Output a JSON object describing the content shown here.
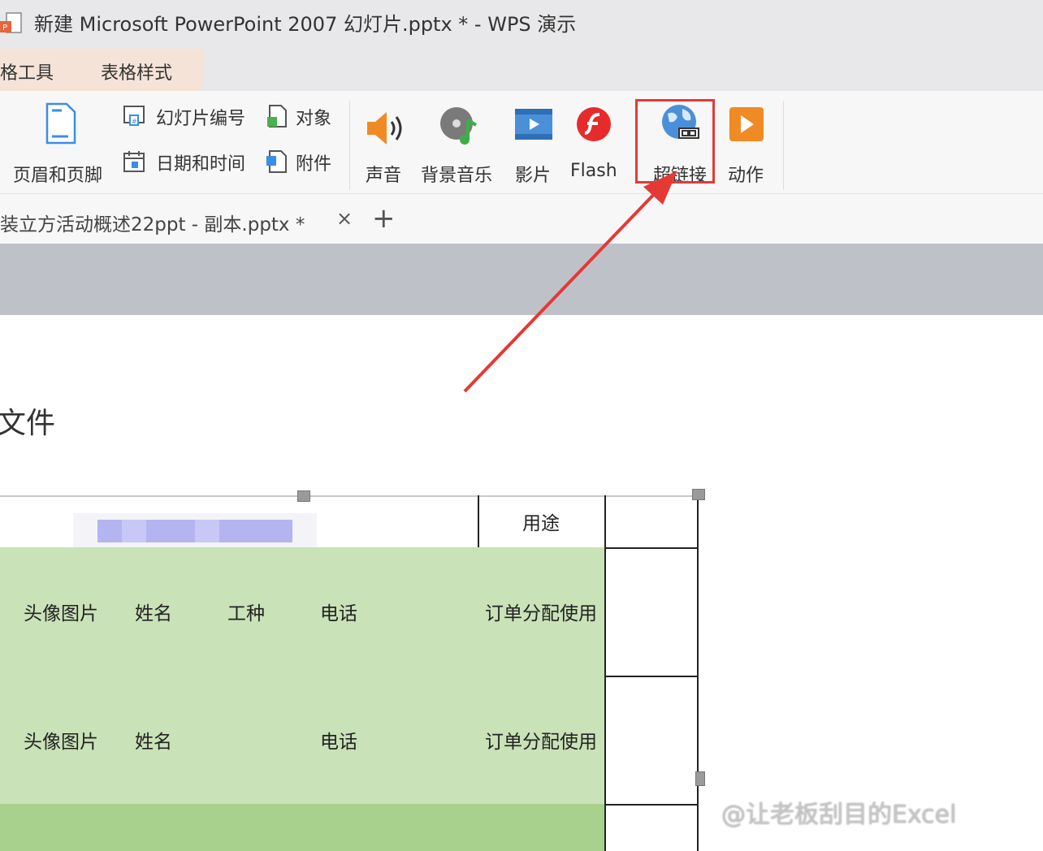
{
  "window": {
    "title": "新建 Microsoft PowerPoint 2007 幻灯片.pptx * - WPS 演示"
  },
  "context_tabs": {
    "table_tools": "格工具",
    "table_style": "表格样式"
  },
  "ribbon": {
    "header_footer": "页眉和页脚",
    "slide_number": "幻灯片编号",
    "date_time": "日期和时间",
    "object": "对象",
    "attachment": "附件",
    "sound": "声音",
    "bg_music": "背景音乐",
    "movie": "影片",
    "flash": "Flash",
    "hyperlink": "超链接",
    "action": "动作"
  },
  "document_tab": {
    "title": "装立方活动概述22ppt - 副本.pptx *",
    "close": "×",
    "new_tab": "+"
  },
  "slide": {
    "heading": "文件",
    "table": {
      "header_usage": "用途",
      "rows": [
        {
          "avatar": "头像图片",
          "name": "姓名",
          "job": "工种",
          "phone": "电话",
          "usage": "订单分配使用"
        },
        {
          "avatar": "头像图片",
          "name": "姓名",
          "job": "",
          "phone": "电话",
          "usage": "订单分配使用"
        }
      ]
    }
  },
  "watermark": "@让老板刮目的Excel",
  "colors": {
    "highlight_red": "#e53935",
    "table_green": "#c9e2b8",
    "table_green_dark": "#a9d18e"
  }
}
